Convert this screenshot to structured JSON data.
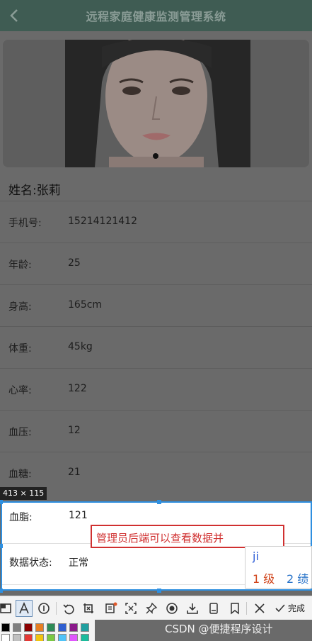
{
  "header": {
    "title": "远程家庭健康监测管理系统",
    "back_icon": "chevron-left-icon"
  },
  "carousel": {
    "active_index": 1,
    "total": 1
  },
  "profile": {
    "name_label": "姓名:",
    "name_value": "张莉",
    "fields": [
      {
        "label": "手机号:",
        "value": "15214121412"
      },
      {
        "label": "年龄:",
        "value": "25"
      },
      {
        "label": "身高:",
        "value": "165cm"
      },
      {
        "label": "体重:",
        "value": "45kg"
      },
      {
        "label": "心率:",
        "value": "122"
      },
      {
        "label": "血压:",
        "value": "12"
      },
      {
        "label": "血糖:",
        "value": "21"
      },
      {
        "label": "血脂:",
        "value": "121"
      },
      {
        "label": "数据状态:",
        "value": "正常"
      }
    ]
  },
  "capture": {
    "size_label": "413 × 115",
    "text_input": "管理员后端可以查看数据并",
    "ime": {
      "composition": "ji",
      "candidate1": "1 级",
      "candidate2": "2 绩"
    },
    "toolbar": {
      "tools": [
        "rectangle-icon",
        "text-icon",
        "number-icon",
        "undo-icon",
        "crop-icon",
        "ocr-icon",
        "pin-icon",
        "translate-icon",
        "record-icon",
        "download-icon",
        "long-capture-icon",
        "bookmark-icon",
        "close-icon"
      ],
      "done_label": "完成"
    },
    "palette": [
      "#000000",
      "#808080",
      "#8b0000",
      "#e67e22",
      "#2e8b57",
      "#2f5fd0",
      "#8b1a8b",
      "#20a0a0",
      "#ffffff",
      "#c0c0c0",
      "#e53935",
      "#f1c40f",
      "#7ac943",
      "#4fc3f7",
      "#e056fd",
      "#1abc9c"
    ]
  },
  "watermark": "CSDN @便捷程序设计",
  "colors": {
    "nav_bg": "#3f5c53",
    "selection": "#2e8fe0",
    "text_box": "#d03030"
  }
}
